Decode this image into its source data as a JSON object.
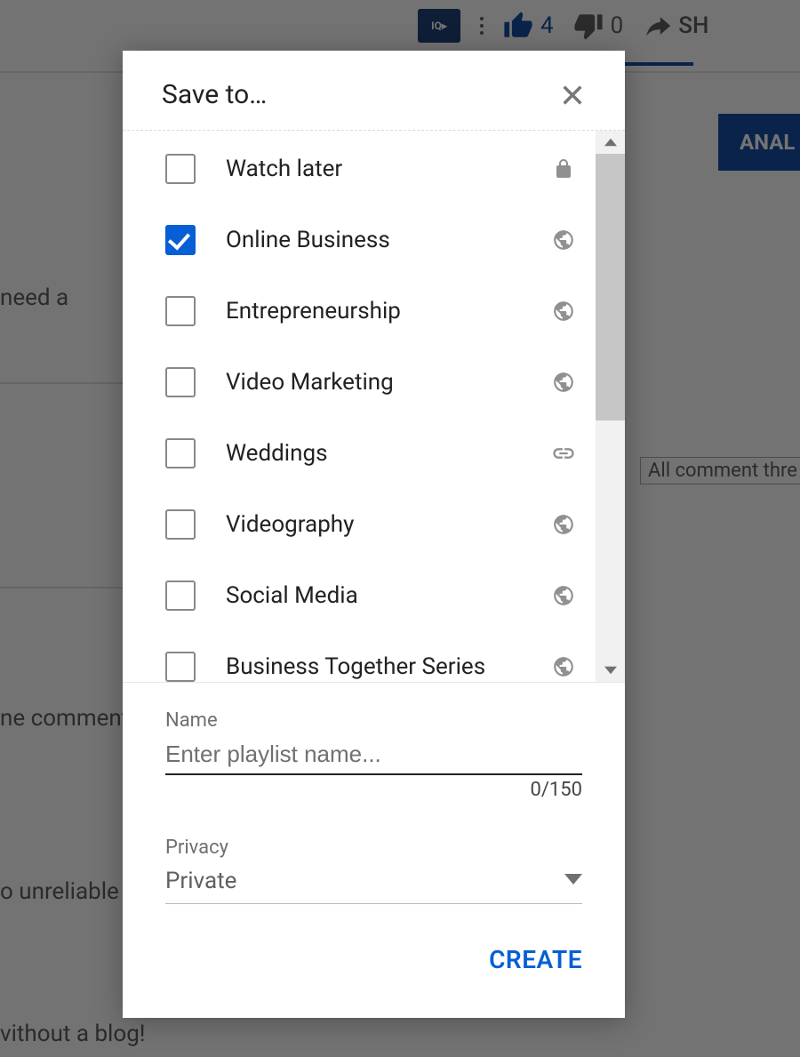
{
  "background": {
    "iq_label": "IQ▸",
    "like_count": "4",
    "dislike_count": "0",
    "share_label": "SH",
    "analyze_label": "ANAL",
    "snippet_need": "need a",
    "snippet_comments_thread": "All comment thre",
    "snippet_the_comment": "ne comment",
    "snippet_unreliable": "o unreliable a",
    "snippet_blog": "vithout a blog!"
  },
  "modal": {
    "title": "Save to…",
    "playlists": [
      {
        "label": "Watch later",
        "checked": false,
        "privacy": "private"
      },
      {
        "label": "Online Business",
        "checked": true,
        "privacy": "public"
      },
      {
        "label": "Entrepreneurship",
        "checked": false,
        "privacy": "public"
      },
      {
        "label": "Video Marketing",
        "checked": false,
        "privacy": "public"
      },
      {
        "label": "Weddings",
        "checked": false,
        "privacy": "unlisted"
      },
      {
        "label": "Videography",
        "checked": false,
        "privacy": "public"
      },
      {
        "label": "Social Media",
        "checked": false,
        "privacy": "public"
      },
      {
        "label": "Business Together Series",
        "checked": false,
        "privacy": "public"
      }
    ],
    "name_field": {
      "label": "Name",
      "placeholder": "Enter playlist name...",
      "value": "",
      "counter": "0/150"
    },
    "privacy_field": {
      "label": "Privacy",
      "value": "Private"
    },
    "create_label": "CREATE"
  }
}
